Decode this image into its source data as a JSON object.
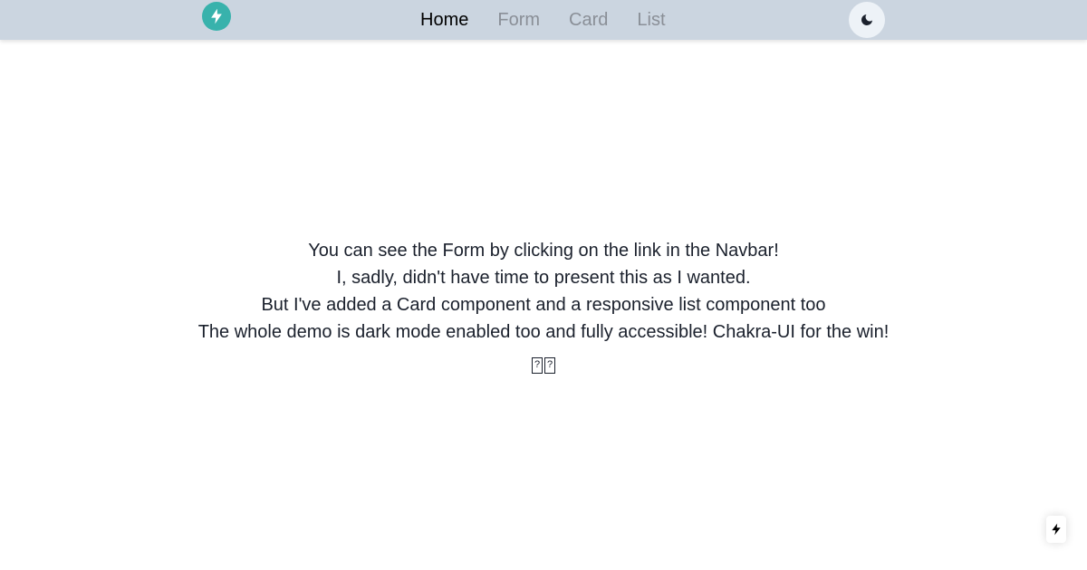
{
  "navbar": {
    "logo_icon": "lightning-bolt-icon",
    "links": [
      {
        "label": "Home",
        "active": true
      },
      {
        "label": "Form",
        "active": false
      },
      {
        "label": "Card",
        "active": false
      },
      {
        "label": "List",
        "active": false
      }
    ],
    "theme_toggle_icon": "moon-icon"
  },
  "main": {
    "lines": [
      "You can see the Form by clicking on the link in the Navbar!",
      "I, sadly, didn't have time to present this as I wanted.",
      "But I've added a Card component and a responsive list component too",
      "The whole demo is dark mode enabled too and fully accessible! Chakra-UI for the win!"
    ],
    "emoji_glyphs": [
      "?",
      "?"
    ]
  },
  "corner_indicator_icon": "lightning-bolt-icon",
  "colors": {
    "navbar_bg": "#cbd5e0",
    "logo_bg": "#38b2ac",
    "active_link": "#000000",
    "inactive_link": "#8a8f97",
    "toggle_bg": "#edf2f7"
  }
}
